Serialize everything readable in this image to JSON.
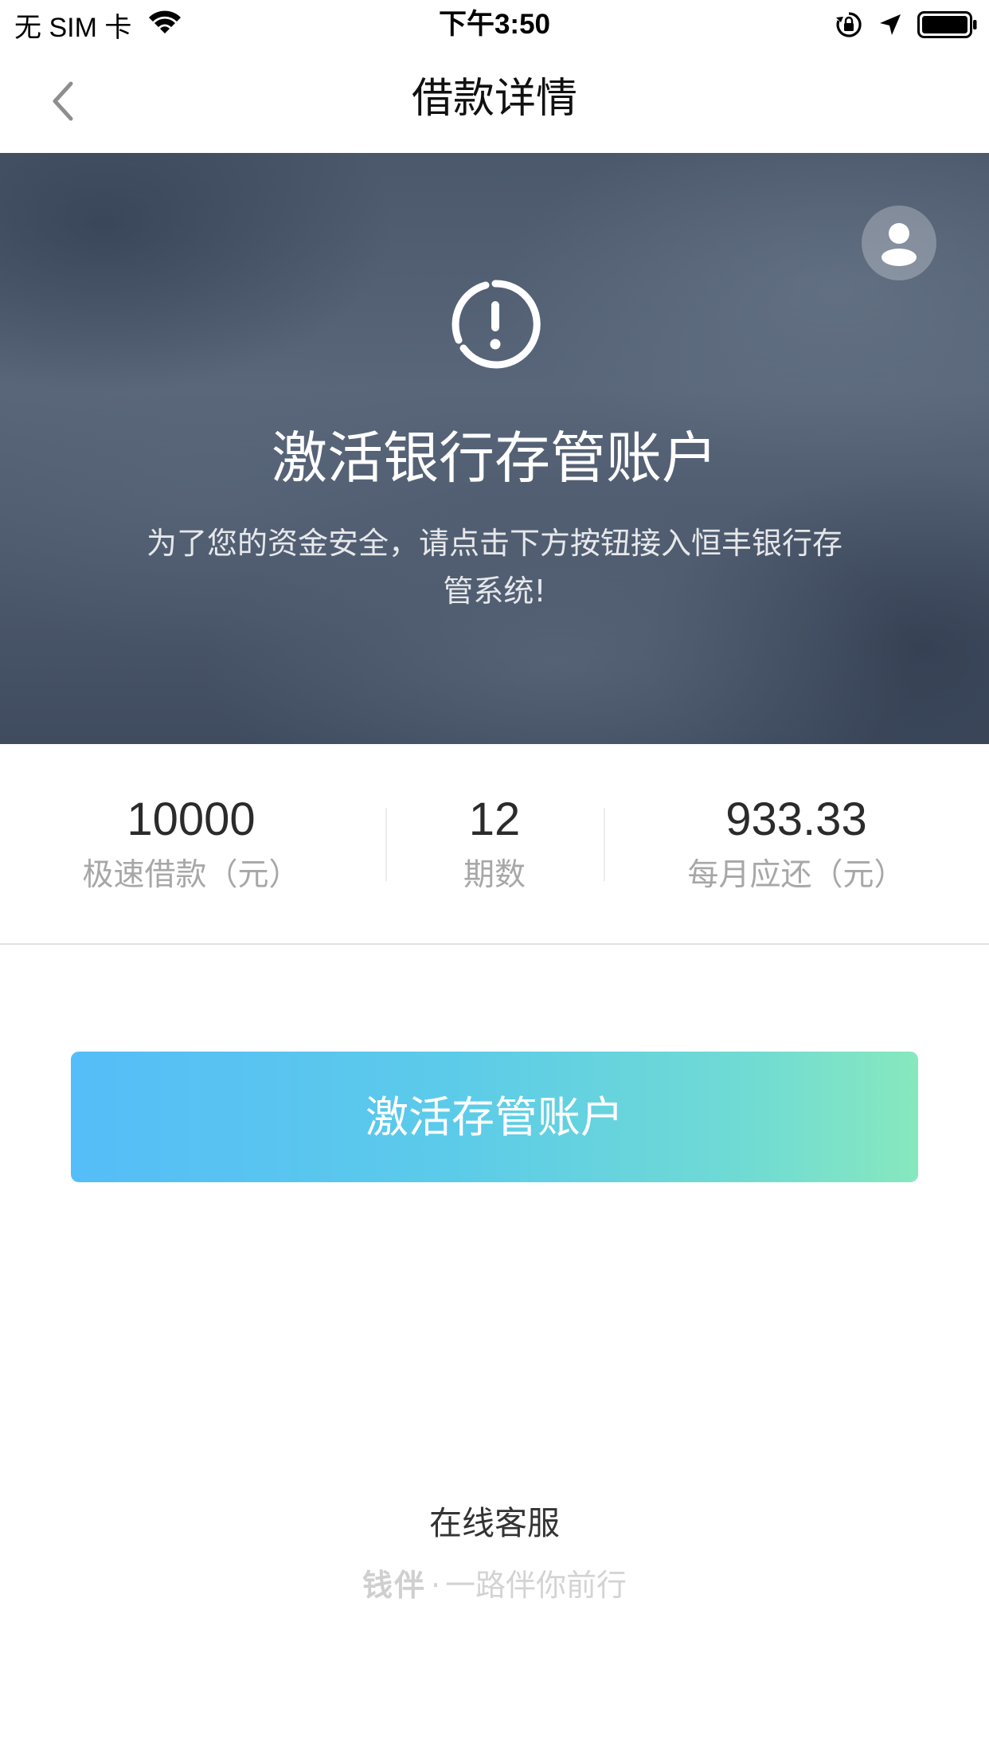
{
  "status_bar": {
    "carrier": "无 SIM 卡",
    "time": "下午3:50"
  },
  "nav": {
    "title": "借款详情"
  },
  "hero": {
    "title": "激活银行存管账户",
    "description": "为了您的资金安全，请点击下方按钮接入恒丰银行存管系统!"
  },
  "stats": [
    {
      "value": "10000",
      "label": "极速借款（元）"
    },
    {
      "value": "12",
      "label": "期数"
    },
    {
      "value": "933.33",
      "label": "每月应还（元）"
    }
  ],
  "actions": {
    "activate_label": "激活存管账户"
  },
  "footer": {
    "service_label": "在线客服",
    "brand_name": "钱伴",
    "separator": "·",
    "slogan": "一路伴你前行"
  },
  "colors": {
    "button_gradient_start": "#55bdf8",
    "button_gradient_end": "#87e8be",
    "hero_background": "#4f5c70"
  }
}
